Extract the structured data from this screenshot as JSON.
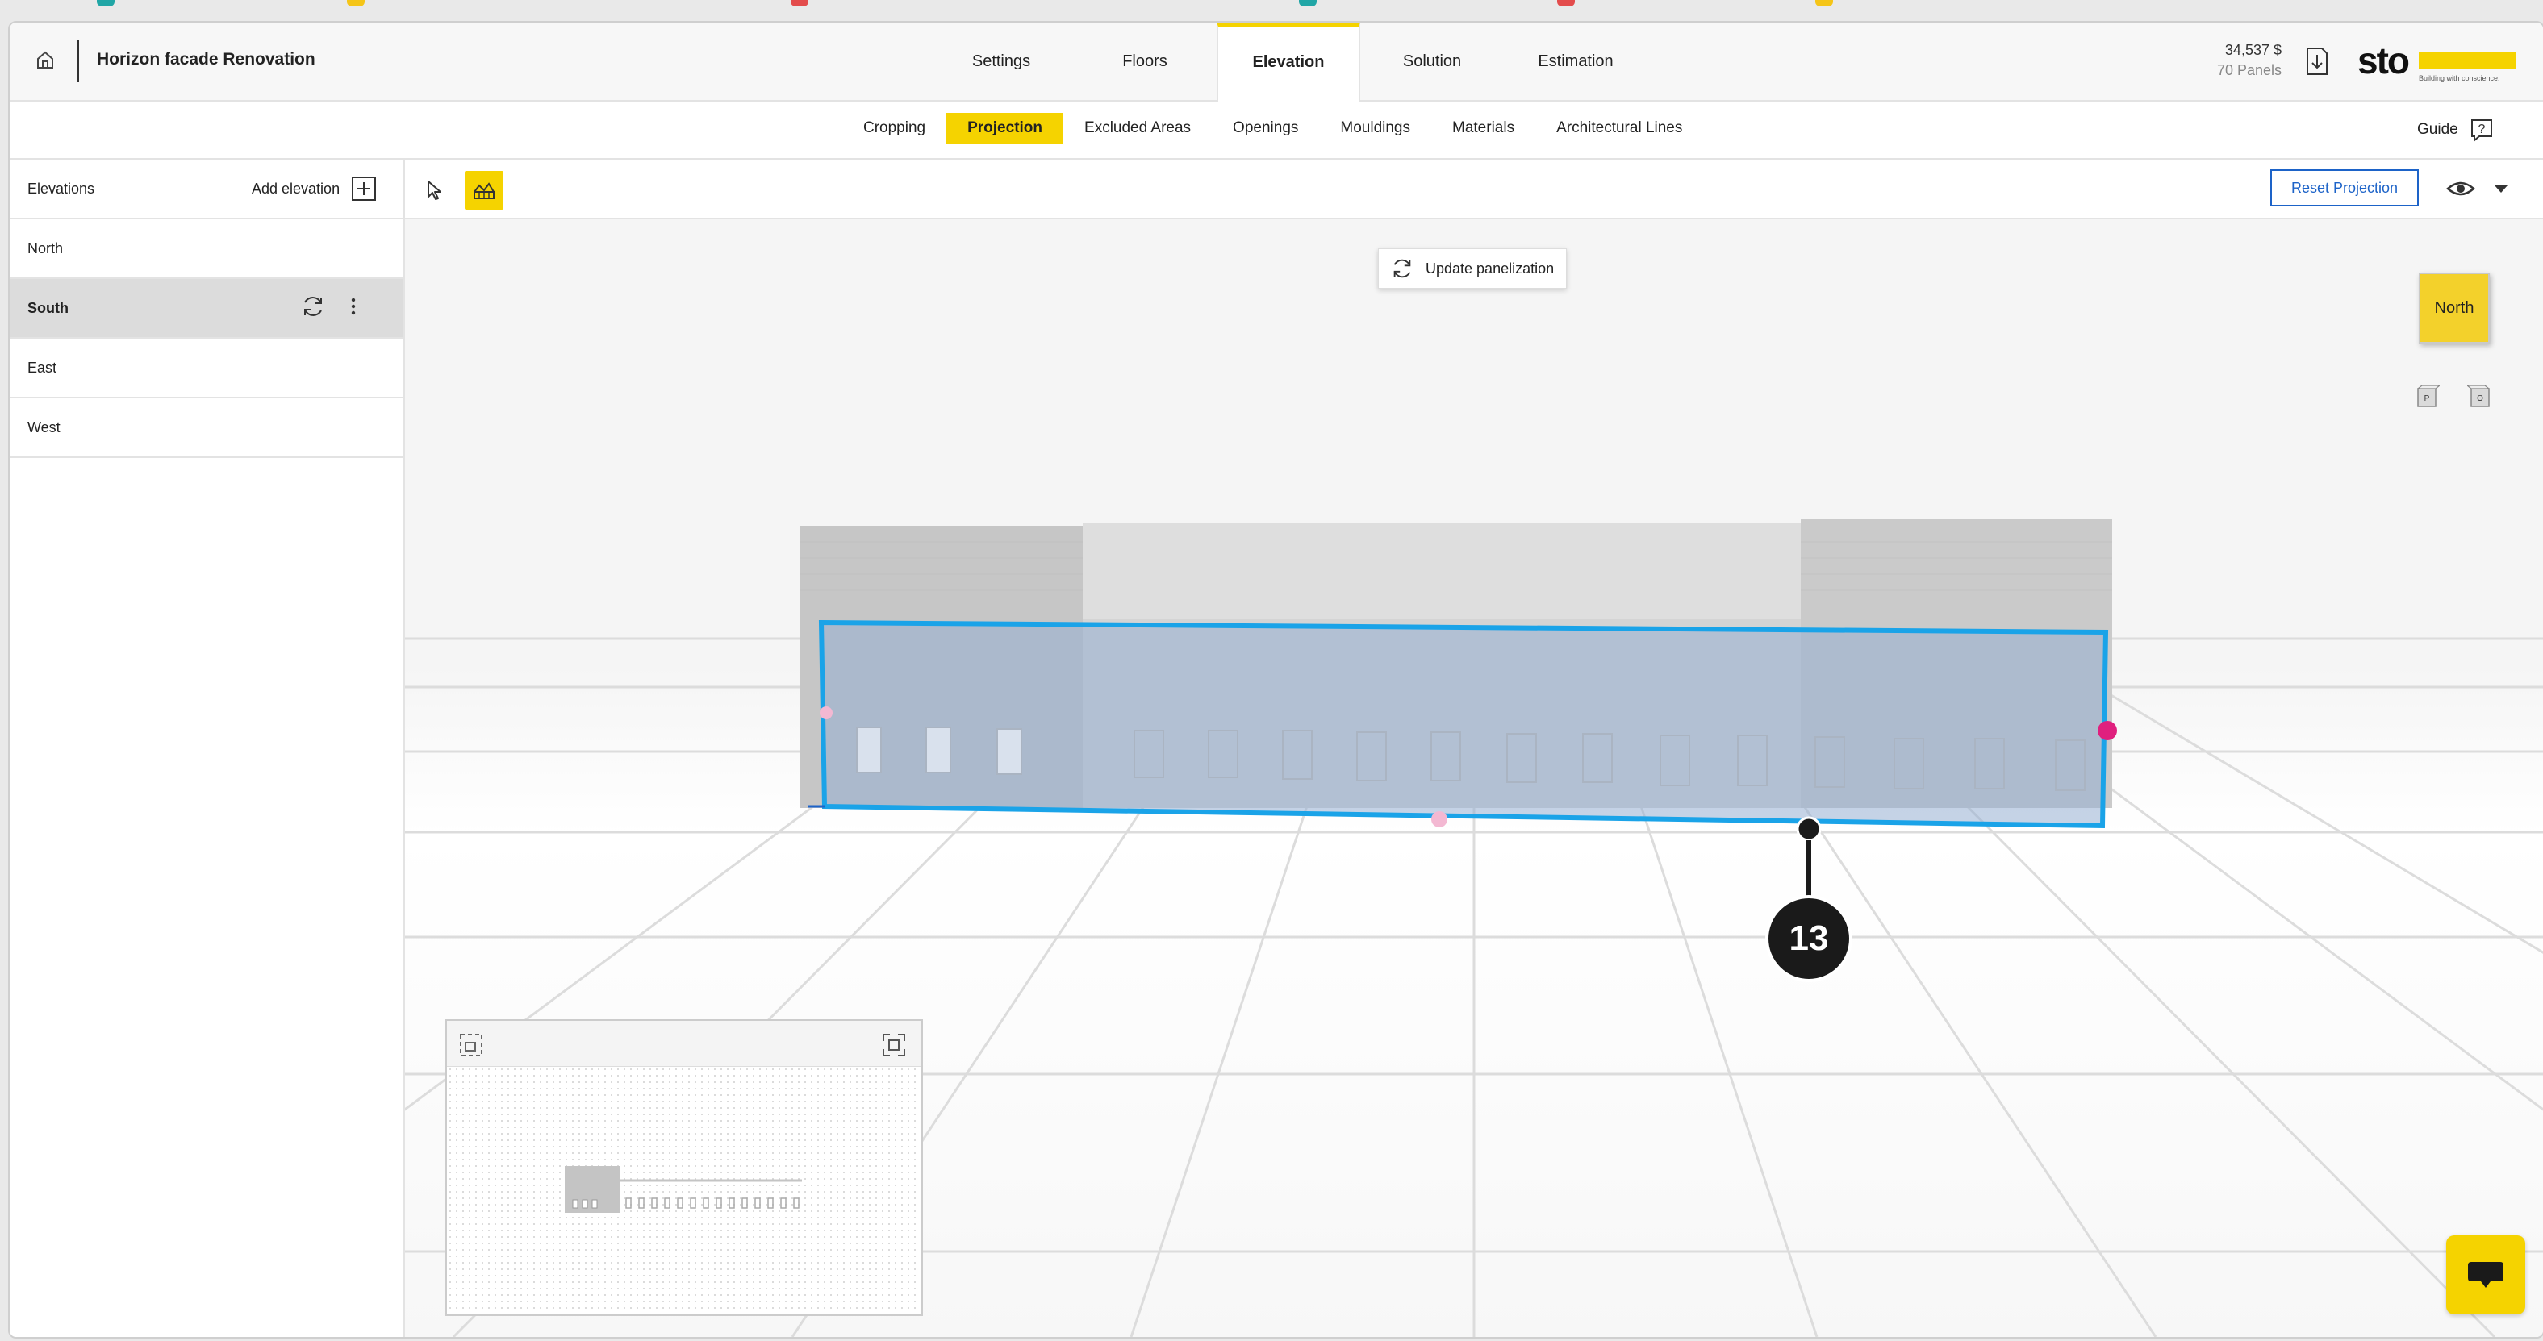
{
  "header": {
    "project_title": "Horizon facade Renovation",
    "main_tabs": [
      "Settings",
      "Floors",
      "Elevation",
      "Solution",
      "Estimation"
    ],
    "active_tab": "Elevation",
    "price": "34,537 $",
    "panels": "70 Panels",
    "logo_text": "sto",
    "logo_tagline": "Building with conscience.",
    "brand_color": "#f5d300"
  },
  "subnav": {
    "items": [
      "Cropping",
      "Projection",
      "Excluded Areas",
      "Openings",
      "Mouldings",
      "Materials",
      "Architectural Lines"
    ],
    "active": "Projection",
    "guide_label": "Guide"
  },
  "sidebar": {
    "title": "Elevations",
    "add_label": "Add elevation",
    "items": [
      {
        "label": "North"
      },
      {
        "label": "South"
      },
      {
        "label": "East"
      },
      {
        "label": "West"
      }
    ],
    "active": "South"
  },
  "toolbar": {
    "reset_label": "Reset Projection",
    "accent_color": "#1d63c8"
  },
  "viewport": {
    "update_label": "Update panelization",
    "nav_cube_label": "North",
    "mini_cube_left": "P",
    "mini_cube_right": "O",
    "step_number": "13",
    "selection_color": "#1aa3e8",
    "handle_color": "#e0207e"
  },
  "icons": [
    "home-icon",
    "download-icon",
    "help-icon",
    "plus-box-icon",
    "refresh-icon",
    "kebab-icon",
    "pointer-icon",
    "projection-tool-icon",
    "eye-icon",
    "caret-down-icon",
    "minimap-fit-icon",
    "expand-icon",
    "chat-icon"
  ]
}
